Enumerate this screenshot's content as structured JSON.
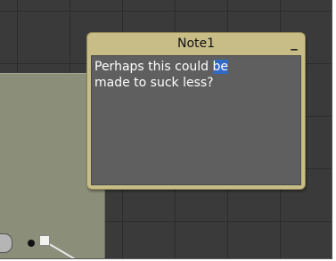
{
  "note": {
    "title": "Note1",
    "minimize_label": "_",
    "text_before": "Perhaps this could ",
    "text_selected": "be",
    "text_after": "\nmade to suck less?"
  },
  "colors": {
    "canvas_background": "#3a3a3a",
    "grid_lines": "#2c2c2c",
    "backdrop_node": "#8b8f79",
    "note_frame": "#c8bd86",
    "note_body": "#5f5f5f",
    "selection": "#316ac5"
  },
  "icons": {
    "minimize": "minimize-icon",
    "output_dot": "output-port-dot-icon",
    "connector": "connector-square-icon"
  }
}
